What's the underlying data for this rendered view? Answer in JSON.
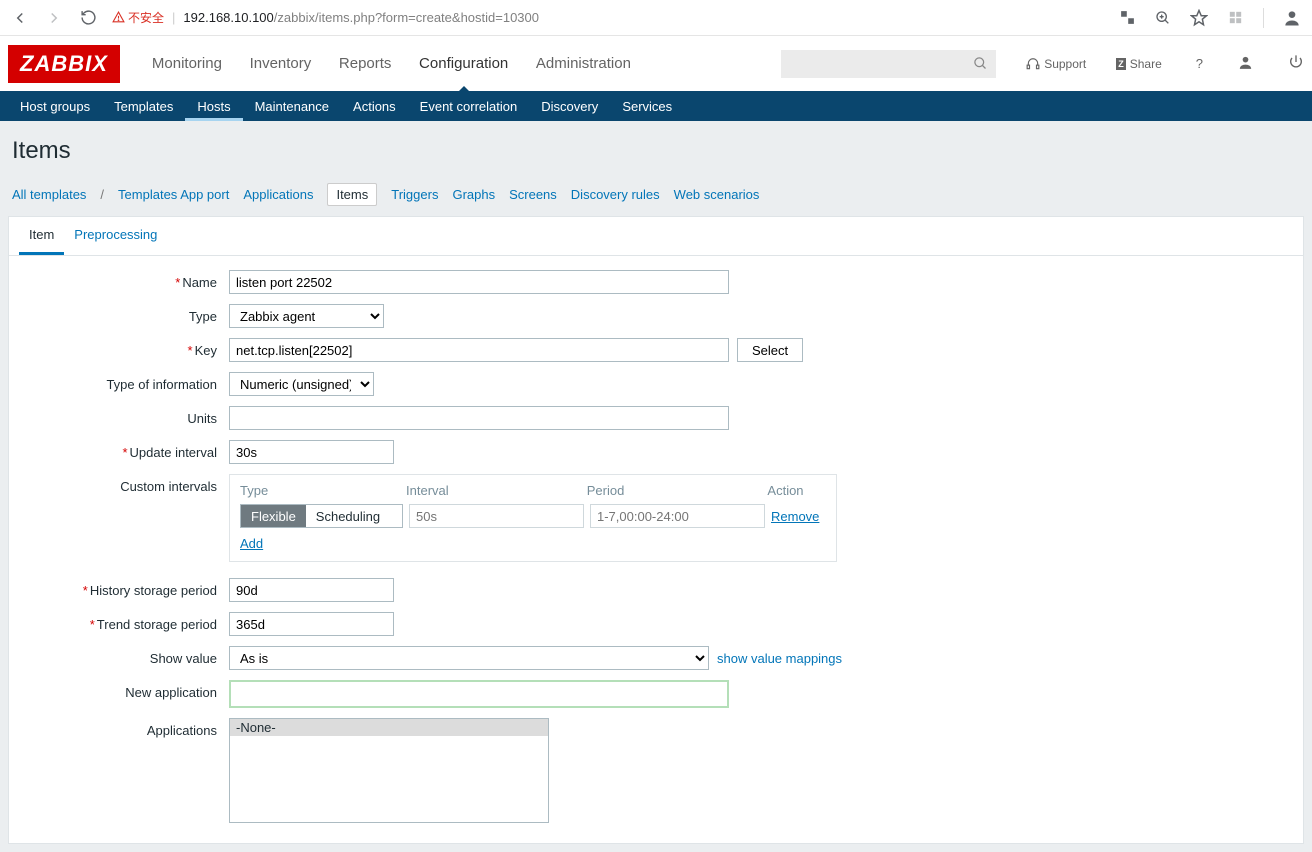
{
  "browser": {
    "not_secure": "不安全",
    "url_host": "192.168.10.100",
    "url_path": "/zabbix/items.php?form=create&hostid=10300"
  },
  "header": {
    "logo": "ZABBIX",
    "nav": [
      "Monitoring",
      "Inventory",
      "Reports",
      "Configuration",
      "Administration"
    ],
    "support": "Support",
    "share": "Share"
  },
  "subnav": [
    "Host groups",
    "Templates",
    "Hosts",
    "Maintenance",
    "Actions",
    "Event correlation",
    "Discovery",
    "Services"
  ],
  "page_title": "Items",
  "bc": [
    "All templates",
    "Templates App port",
    "Applications",
    "Items",
    "Triggers",
    "Graphs",
    "Screens",
    "Discovery rules",
    "Web scenarios"
  ],
  "tabs": {
    "item": "Item",
    "preproc": "Preprocessing"
  },
  "labels": {
    "name": "Name",
    "type": "Type",
    "key": "Key",
    "toi": "Type of information",
    "units": "Units",
    "update": "Update interval",
    "custom": "Custom intervals",
    "history": "History storage period",
    "trend": "Trend storage period",
    "showvalue": "Show value",
    "newapp": "New application",
    "apps": "Applications"
  },
  "values": {
    "name": "listen port 22502",
    "type": "Zabbix agent",
    "key": "net.tcp.listen[22502]",
    "toi": "Numeric (unsigned)",
    "units": "",
    "update": "30s",
    "history": "90d",
    "trend": "365d",
    "showvalue": "As is",
    "newapp": "",
    "apps_none": "-None-"
  },
  "buttons": {
    "select": "Select",
    "showmap": "show value mappings"
  },
  "ci": {
    "h_type": "Type",
    "h_interval": "Interval",
    "h_period": "Period",
    "h_action": "Action",
    "flexible": "Flexible",
    "scheduling": "Scheduling",
    "interval_ph": "50s",
    "period_ph": "1-7,00:00-24:00",
    "remove": "Remove",
    "add": "Add"
  }
}
